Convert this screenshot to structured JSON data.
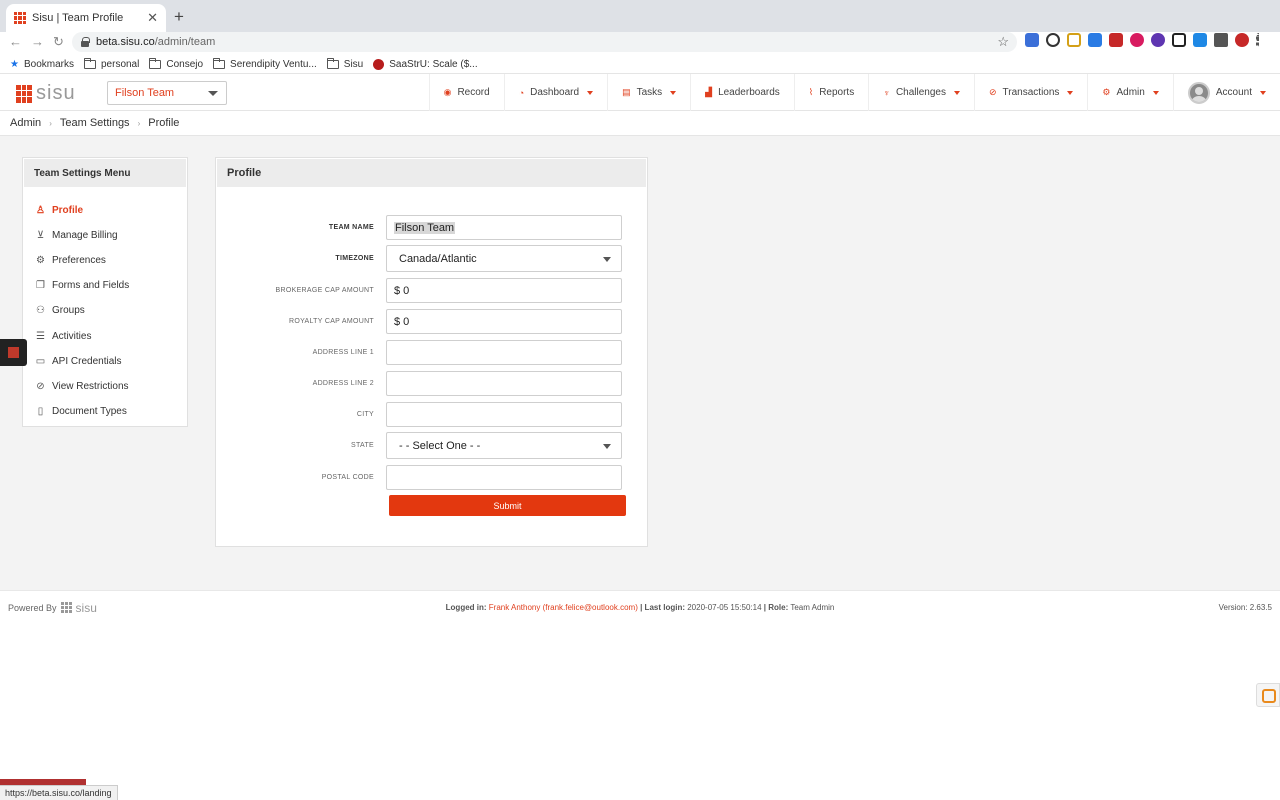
{
  "browser": {
    "tab_title": "Sisu | Team Profile",
    "url_host": "beta.sisu.co",
    "url_path": "/admin/team",
    "bookmarks": [
      "Bookmarks",
      "personal",
      "Consejo",
      "Serendipity Ventu...",
      "Sisu",
      "SaaStrU: Scale ($..."
    ],
    "status_url": "https://beta.sisu.co/landing"
  },
  "header": {
    "logo_text": "sisu",
    "team_selector": "Filson Team",
    "nav": {
      "record": "Record",
      "dashboard": "Dashboard",
      "tasks": "Tasks",
      "leaderboards": "Leaderboards",
      "reports": "Reports",
      "challenges": "Challenges",
      "transactions": "Transactions",
      "admin": "Admin",
      "account": "Account"
    }
  },
  "breadcrumb": [
    "Admin",
    "Team Settings",
    "Profile"
  ],
  "menu": {
    "title": "Team Settings Menu",
    "items": [
      "Profile",
      "Manage Billing",
      "Preferences",
      "Forms and Fields",
      "Groups",
      "Activities",
      "API Credentials",
      "View Restrictions",
      "Document Types"
    ]
  },
  "profile": {
    "title": "Profile",
    "fields": {
      "team_name_label": "TEAM NAME",
      "team_name_value": "Filson Team",
      "timezone_label": "TIMEZONE",
      "timezone_value": "Canada/Atlantic",
      "brokerage_cap_label": "BROKERAGE CAP AMOUNT",
      "brokerage_cap_value": "$ 0",
      "royalty_cap_label": "ROYALTY CAP AMOUNT",
      "royalty_cap_value": "$ 0",
      "address1_label": "ADDRESS LINE 1",
      "address2_label": "ADDRESS LINE 2",
      "city_label": "CITY",
      "state_label": "STATE",
      "state_value": "- - Select One - -",
      "postal_label": "POSTAL CODE"
    },
    "submit_label": "Submit"
  },
  "footer": {
    "powered_by": "Powered By",
    "logo_text": "sisu",
    "logged_in_label": "Logged in:",
    "logged_in_user": "Frank Anthony (frank.felice@outlook.com)",
    "last_login_label": "| Last login:",
    "last_login_value": "2020-07-05 15:50:14",
    "role_label": "| Role:",
    "role_value": "Team Admin",
    "version": "Version: 2.63.5"
  },
  "colors": {
    "accent": "#e0401f",
    "submit": "#e3380f"
  }
}
